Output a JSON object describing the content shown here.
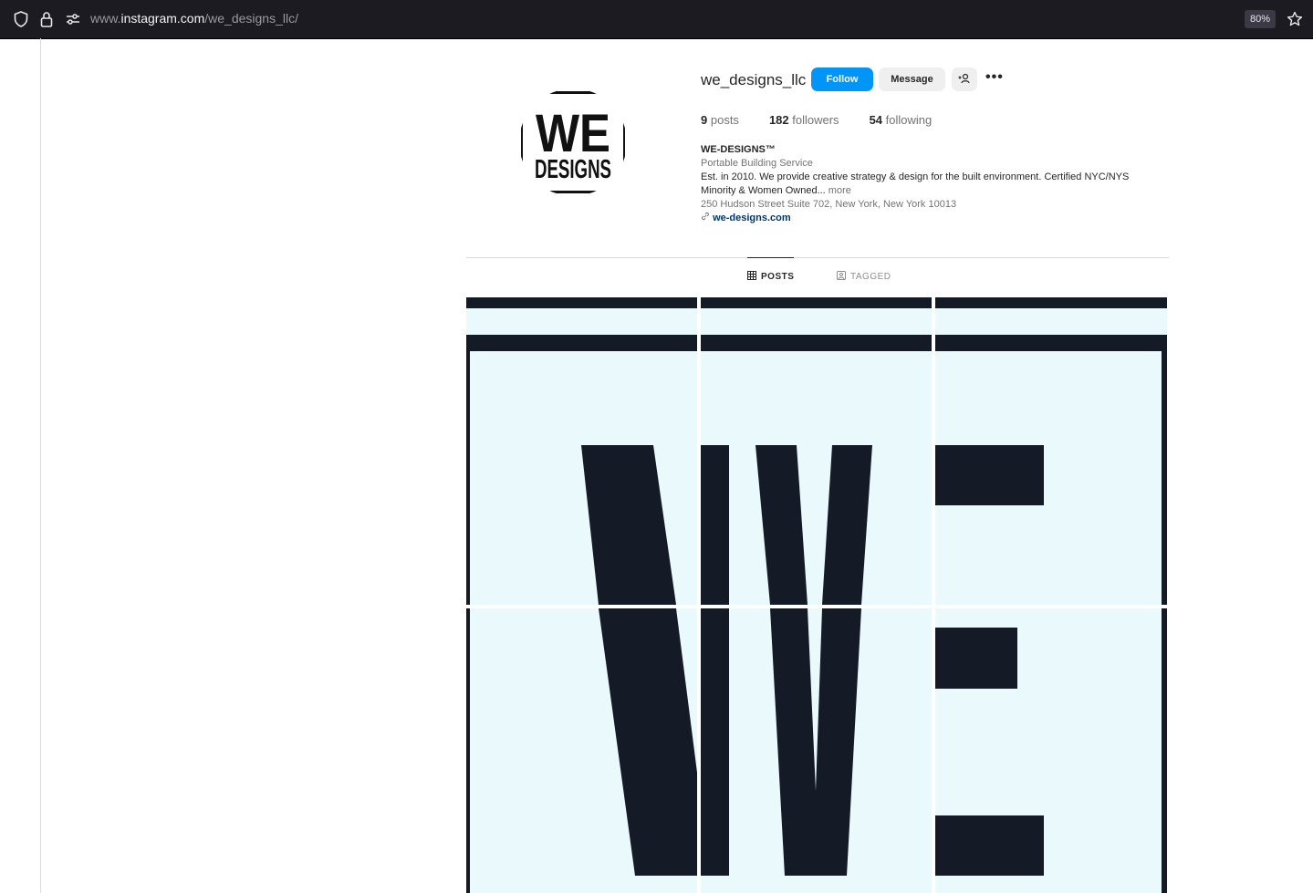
{
  "browser": {
    "url_prefix": "www.",
    "url_host": "instagram.com",
    "url_path": "/we_designs_llc/",
    "zoom": "80%"
  },
  "profile": {
    "avatar_top_word": "WE",
    "avatar_bottom_word": "DESIGNS",
    "username": "we_designs_llc",
    "follow_label": "Follow",
    "message_label": "Message",
    "more_label": "•••",
    "stats": {
      "posts_count": "9",
      "posts_label": "posts",
      "followers_count": "182",
      "followers_label": "followers",
      "following_count": "54",
      "following_label": "following"
    },
    "bio": {
      "name": "WE-DESIGNS™",
      "category": "Portable Building Service",
      "text": "Est. in 2010. We provide creative strategy & design for the built environment. Certified NYC/NYS Minority & Women Owned...",
      "more": "more",
      "address": "250 Hudson Street Suite 702, New York, New York 10013",
      "link": "we-designs.com"
    }
  },
  "tabs": {
    "posts": "POSTS",
    "tagged": "TAGGED"
  },
  "posts": {
    "count_visible": 6,
    "description": "tiles form one large 'WE' graphic"
  },
  "colors": {
    "follow_blue": "#0095f6",
    "tile_bg": "#eaf9fb",
    "tile_ink": "#141b26",
    "browser_bar": "#1c1b22"
  }
}
